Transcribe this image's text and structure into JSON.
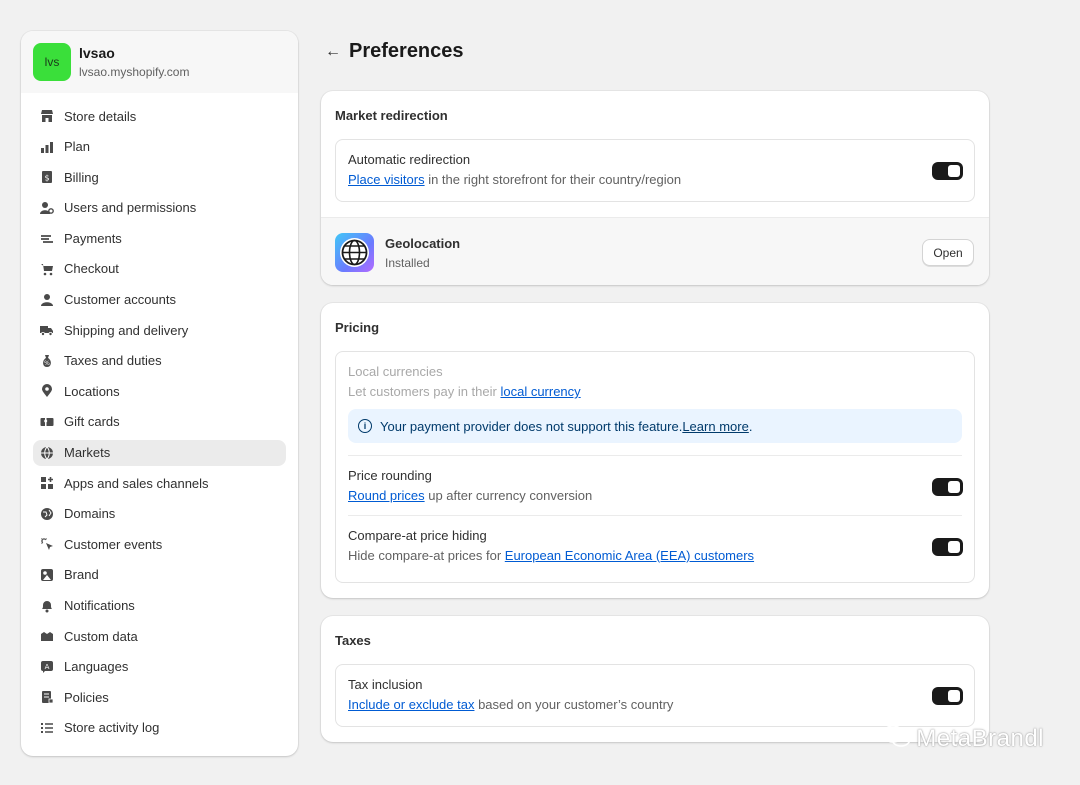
{
  "store": {
    "avatar_initials": "lvs",
    "name": "lvsao",
    "domain": "lvsao.myshopify.com",
    "avatar_color": "#3adf3a"
  },
  "sidebar": {
    "items": [
      {
        "label": "Store details",
        "icon": "store-icon"
      },
      {
        "label": "Plan",
        "icon": "plan-icon"
      },
      {
        "label": "Billing",
        "icon": "billing-icon"
      },
      {
        "label": "Users and permissions",
        "icon": "users-icon"
      },
      {
        "label": "Payments",
        "icon": "payments-icon"
      },
      {
        "label": "Checkout",
        "icon": "cart-icon"
      },
      {
        "label": "Customer accounts",
        "icon": "person-icon"
      },
      {
        "label": "Shipping and delivery",
        "icon": "truck-icon"
      },
      {
        "label": "Taxes and duties",
        "icon": "tax-icon"
      },
      {
        "label": "Locations",
        "icon": "location-icon"
      },
      {
        "label": "Gift cards",
        "icon": "gift-card-icon"
      },
      {
        "label": "Markets",
        "icon": "globe-market-icon",
        "active": true
      },
      {
        "label": "Apps and sales channels",
        "icon": "apps-icon"
      },
      {
        "label": "Domains",
        "icon": "domains-icon"
      },
      {
        "label": "Customer events",
        "icon": "cursor-icon"
      },
      {
        "label": "Brand",
        "icon": "brand-icon"
      },
      {
        "label": "Notifications",
        "icon": "bell-icon"
      },
      {
        "label": "Custom data",
        "icon": "custom-data-icon"
      },
      {
        "label": "Languages",
        "icon": "language-icon"
      },
      {
        "label": "Policies",
        "icon": "policies-icon"
      },
      {
        "label": "Store activity log",
        "icon": "list-icon"
      }
    ]
  },
  "page": {
    "title": "Preferences"
  },
  "market_redirection": {
    "title": "Market redirection",
    "auto_redirect": {
      "title": "Automatic redirection",
      "link": "Place visitors",
      "desc_rest": " in the right storefront for their country/region",
      "enabled": true
    },
    "geolocation": {
      "name": "Geolocation",
      "status": "Installed",
      "open_label": "Open"
    }
  },
  "pricing": {
    "title": "Pricing",
    "local_currencies": {
      "title": "Local currencies",
      "desc_pre": "Let customers pay in their ",
      "link": "local currency"
    },
    "banner": {
      "text": "Your payment provider does not support this feature. ",
      "link": "Learn more",
      "suffix": "."
    },
    "price_rounding": {
      "title": "Price rounding",
      "link": "Round prices",
      "desc_rest": " up after currency conversion",
      "enabled": true
    },
    "compare_at": {
      "title": "Compare-at price hiding",
      "desc_pre": "Hide compare-at prices for ",
      "link": "European Economic Area (EEA) customers",
      "enabled": true
    }
  },
  "taxes": {
    "title": "Taxes",
    "tax_inclusion": {
      "title": "Tax inclusion",
      "link": "Include or exclude tax",
      "desc_rest": " based on your customer’s country",
      "enabled": true
    }
  },
  "watermark": {
    "text": "MetaBrandl"
  },
  "colors": {
    "accent_link": "#005bd3",
    "toggle_on": "#1a1a1a",
    "banner_bg": "#eaf4ff"
  }
}
